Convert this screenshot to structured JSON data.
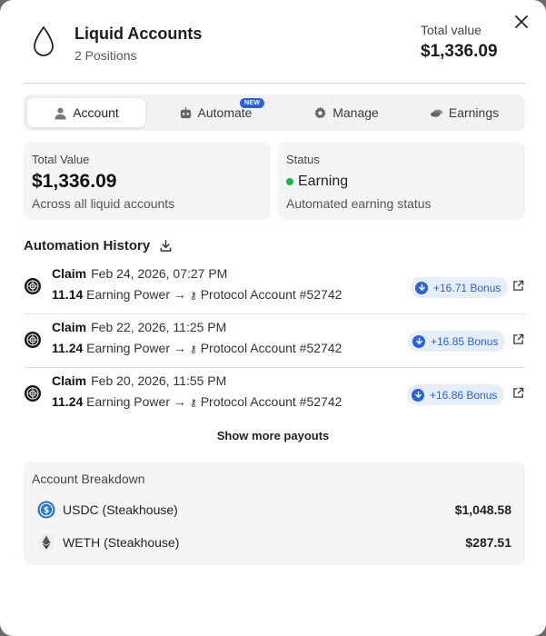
{
  "header": {
    "title": "Liquid Accounts",
    "subtitle": "2 Positions",
    "total_value_label": "Total value",
    "total_value": "$1,336.09",
    "icon": "droplet-icon",
    "close_icon": "close-icon"
  },
  "tabs": [
    {
      "label": "Account",
      "icon": "user-icon",
      "active": true
    },
    {
      "label": "Automate",
      "icon": "robot-icon",
      "badge": "NEW"
    },
    {
      "label": "Manage",
      "icon": "gear-icon"
    },
    {
      "label": "Earnings",
      "icon": "coins-icon"
    }
  ],
  "cards": {
    "total": {
      "label": "Total Value",
      "value": "$1,336.09",
      "sub": "Across all liquid accounts"
    },
    "status": {
      "label": "Status",
      "value": "Earning",
      "sub": "Automated earning status",
      "dot_color": "#22b04b"
    }
  },
  "automation_history": {
    "title": "Automation History",
    "rows": [
      {
        "action": "Claim",
        "date": "Feb 24, 2026, 07:27 PM",
        "amount": "11.14",
        "power_label": "Earning Power",
        "target": "Protocol Account #52742",
        "bonus": "+16.71 Bonus"
      },
      {
        "action": "Claim",
        "date": "Feb 22, 2026, 11:25 PM",
        "amount": "11.24",
        "power_label": "Earning Power",
        "target": "Protocol Account #52742",
        "bonus": "+16.85 Bonus"
      },
      {
        "action": "Claim",
        "date": "Feb 20, 2026, 11:55 PM",
        "amount": "11.24",
        "power_label": "Earning Power",
        "target": "Protocol Account #52742",
        "bonus": "+16.86 Bonus"
      }
    ],
    "show_more": "Show more payouts"
  },
  "breakdown": {
    "title": "Account Breakdown",
    "items": [
      {
        "name": "USDC (Steakhouse)",
        "value": "$1,048.58",
        "icon": "usdc-icon"
      },
      {
        "name": "WETH (Steakhouse)",
        "value": "$287.51",
        "icon": "eth-icon"
      }
    ]
  },
  "colors": {
    "accent": "#2a62d8",
    "bonus_bg": "#e6eefc",
    "success": "#22b04b"
  }
}
